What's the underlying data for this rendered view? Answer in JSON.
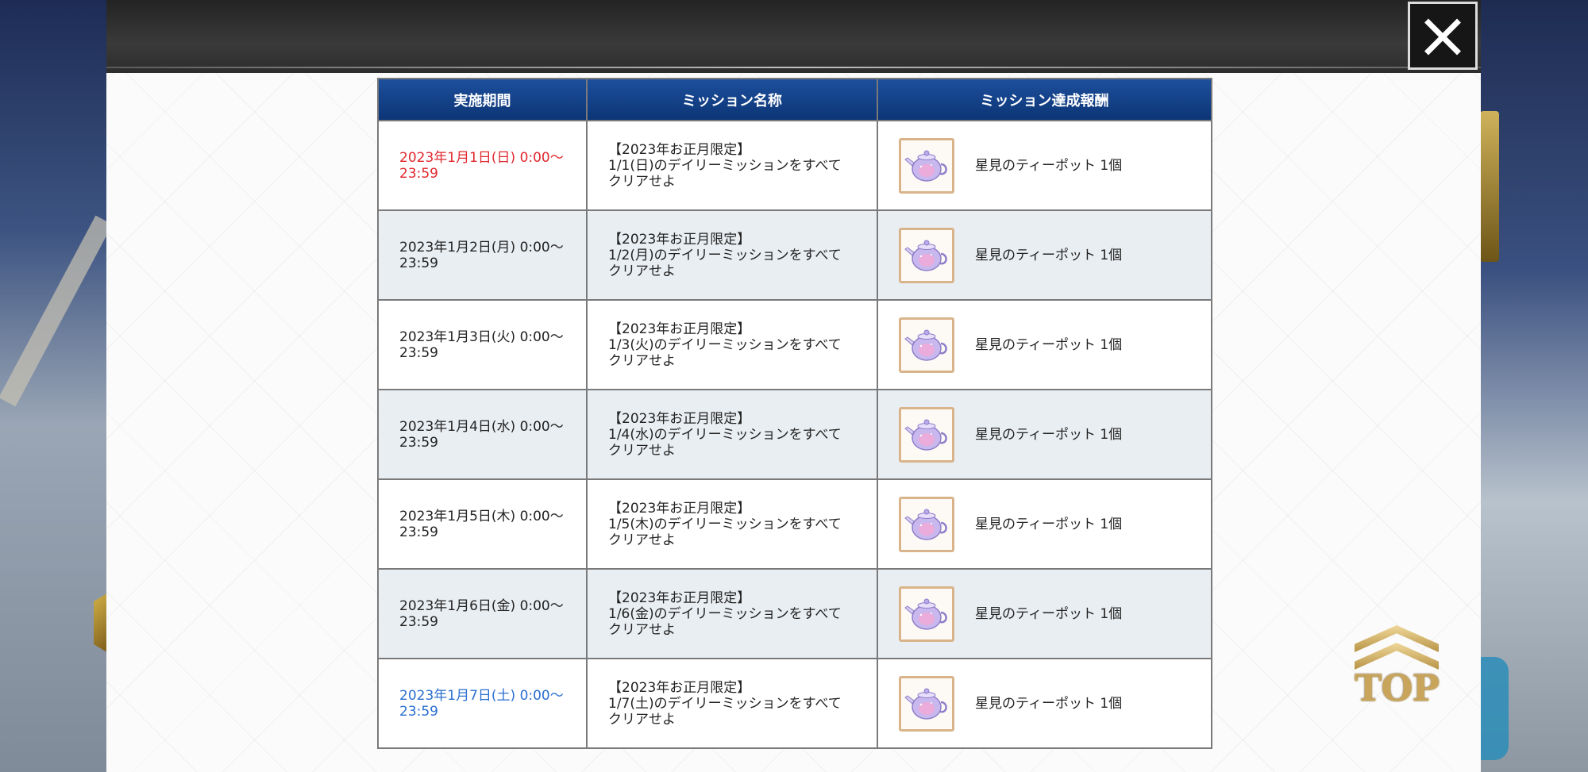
{
  "table": {
    "headers": [
      "実施期間",
      "ミッション名称",
      "ミッション達成報酬"
    ],
    "rows": [
      {
        "period_line1": "2023年1月1日(日) 0:00～",
        "period_line2": "23:59",
        "mission_line1": "【2023年お正月限定】",
        "mission_line2": "1/1(日)のデイリーミッションをすべて",
        "mission_line3": "クリアせよ",
        "reward": "星見のティーポット 1個",
        "period_color": "#e0282e"
      },
      {
        "period_line1": "2023年1月2日(月) 0:00～",
        "period_line2": "23:59",
        "mission_line1": "【2023年お正月限定】",
        "mission_line2": "1/2(月)のデイリーミッションをすべて",
        "mission_line3": "クリアせよ",
        "reward": "星見のティーポット 1個",
        "period_color": "#222222"
      },
      {
        "period_line1": "2023年1月3日(火) 0:00～",
        "period_line2": "23:59",
        "mission_line1": "【2023年お正月限定】",
        "mission_line2": "1/3(火)のデイリーミッションをすべて",
        "mission_line3": "クリアせよ",
        "reward": "星見のティーポット 1個",
        "period_color": "#222222"
      },
      {
        "period_line1": "2023年1月4日(水) 0:00～",
        "period_line2": "23:59",
        "mission_line1": "【2023年お正月限定】",
        "mission_line2": "1/4(水)のデイリーミッションをすべて",
        "mission_line3": "クリアせよ",
        "reward": "星見のティーポット 1個",
        "period_color": "#222222"
      },
      {
        "period_line1": "2023年1月5日(木) 0:00～",
        "period_line2": "23:59",
        "mission_line1": "【2023年お正月限定】",
        "mission_line2": "1/5(木)のデイリーミッションをすべて",
        "mission_line3": "クリアせよ",
        "reward": "星見のティーポット 1個",
        "period_color": "#222222"
      },
      {
        "period_line1": "2023年1月6日(金) 0:00～",
        "period_line2": "23:59",
        "mission_line1": "【2023年お正月限定】",
        "mission_line2": "1/6(金)のデイリーミッションをすべて",
        "mission_line3": "クリアせよ",
        "reward": "星見のティーポット 1個",
        "period_color": "#222222"
      },
      {
        "period_line1": "2023年1月7日(土) 0:00～",
        "period_line2": "23:59",
        "mission_line1": "【2023年お正月限定】",
        "mission_line2": "1/7(土)のデイリーミッションをすべて",
        "mission_line3": "クリアせよ",
        "reward": "星見のティーポット 1個",
        "period_color": "#2a6fd0"
      }
    ]
  },
  "reward_icon": "teapot-icon",
  "close_icon": "close-icon",
  "top_button": {
    "label": "TOP",
    "icon": "chevron-up-icon"
  },
  "colors": {
    "header_blue": "#0c3576",
    "sunday_red": "#e0282e",
    "saturday_blue": "#2a6fd0",
    "row_alt": "#e9eef2"
  }
}
